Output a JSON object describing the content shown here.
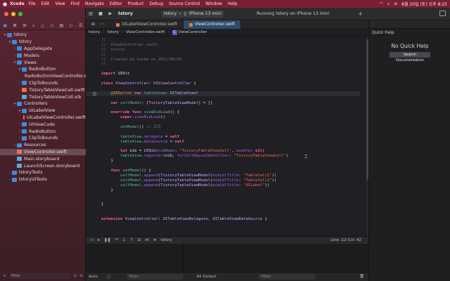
{
  "menubar": {
    "app": "Xcode",
    "items": [
      "File",
      "Edit",
      "View",
      "Find",
      "Navigate",
      "Editor",
      "Product",
      "Debug",
      "Source Control",
      "Window",
      "Help"
    ],
    "clock": "8월 20일 (토) 오후 8:25"
  },
  "toolbar": {
    "project_name": "tstory",
    "scheme": "tstory",
    "device": "iPhone 13 mini",
    "status": "Running tstory on iPhone 13 mini"
  },
  "tabs": [
    {
      "label": "UILabelViewController.swift",
      "active": false
    },
    {
      "label": "ViewController.swift",
      "active": true
    }
  ],
  "breadcrumb": [
    "tstory",
    "tstory",
    "ViewController.swift",
    "ViewController"
  ],
  "navigator": {
    "filter_placeholder": "Filter",
    "rows": [
      {
        "label": "tstory",
        "icon": "proj",
        "indent": 0,
        "disc": "▾"
      },
      {
        "label": "tstory",
        "icon": "folder",
        "indent": 1,
        "disc": "▾"
      },
      {
        "label": "AppDelegate",
        "icon": "folder",
        "indent": 2,
        "disc": "›"
      },
      {
        "label": "Models",
        "icon": "folder",
        "indent": 2,
        "disc": "›"
      },
      {
        "label": "Views",
        "icon": "folder",
        "indent": 2,
        "disc": "▾"
      },
      {
        "label": "RadioButton",
        "icon": "folder",
        "indent": 3,
        "disc": "▾"
      },
      {
        "label": "RadioButtonViewController.swift",
        "icon": "swift",
        "indent": 4,
        "disc": ""
      },
      {
        "label": "ClipToBounds",
        "icon": "folder",
        "indent": 3,
        "disc": "›"
      },
      {
        "label": "TistoryTableViewCell.swift",
        "icon": "swift",
        "indent": 3,
        "disc": ""
      },
      {
        "label": "TistoryTableViewCell.xib",
        "icon": "xib",
        "indent": 3,
        "disc": ""
      },
      {
        "label": "Controllers",
        "icon": "folder",
        "indent": 2,
        "disc": "▾"
      },
      {
        "label": "UILabelView",
        "icon": "folder",
        "indent": 3,
        "disc": "▾"
      },
      {
        "label": "UILabelViewController.swift",
        "icon": "swift",
        "indent": 4,
        "disc": ""
      },
      {
        "label": "UIViewCode",
        "icon": "folder",
        "indent": 3,
        "disc": "›"
      },
      {
        "label": "RadioButton",
        "icon": "folder",
        "indent": 3,
        "disc": "›"
      },
      {
        "label": "ClipToBounds",
        "icon": "folder",
        "indent": 3,
        "disc": "›"
      },
      {
        "label": "Resources",
        "icon": "folder",
        "indent": 2,
        "disc": "›"
      },
      {
        "label": "ViewController.swift",
        "icon": "swift",
        "indent": 2,
        "disc": "",
        "selected": true
      },
      {
        "label": "Main.storyboard",
        "icon": "xib",
        "indent": 2,
        "disc": ""
      },
      {
        "label": "LaunchScreen.storyboard",
        "icon": "xib",
        "indent": 2,
        "disc": ""
      },
      {
        "label": "tstoryTests",
        "icon": "folder",
        "indent": 1,
        "disc": "›"
      },
      {
        "label": "tstoryUITests",
        "icon": "folder",
        "indent": 1,
        "disc": "›"
      }
    ]
  },
  "code_lines": [
    [
      [
        "c-comment",
        "//"
      ]
    ],
    [
      [
        "c-comment",
        "//  ViewController.swift"
      ]
    ],
    [
      [
        "c-comment",
        "//  tstory"
      ]
    ],
    [
      [
        "c-comment",
        "//"
      ]
    ],
    [
      [
        "c-comment",
        "//  Created by tuche on 2022/08/02."
      ]
    ],
    [
      [
        "c-comment",
        "//"
      ]
    ],
    [],
    [
      [
        "c-kw",
        "import"
      ],
      [
        "c-plain",
        " UIKit"
      ]
    ],
    [],
    [
      [
        "c-kw",
        "class"
      ],
      [
        "c-plain",
        " "
      ],
      [
        "c-type",
        "ViewController"
      ],
      [
        "c-plain",
        ": "
      ],
      [
        "c-type",
        "UIViewController"
      ],
      [
        "c-plain",
        " {"
      ]
    ],
    [],
    [
      [
        "c-plain",
        "    "
      ],
      [
        "c-attr",
        "@IBOutlet"
      ],
      [
        "c-plain",
        " "
      ],
      [
        "c-kw",
        "var"
      ],
      [
        "c-plain",
        " "
      ],
      [
        "c-prop",
        "tableView"
      ],
      [
        "c-plain",
        ": "
      ],
      [
        "c-type",
        "UITableView"
      ],
      [
        "c-plain",
        "!"
      ]
    ],
    [],
    [
      [
        "c-plain",
        "    "
      ],
      [
        "c-kw",
        "var"
      ],
      [
        "c-plain",
        " "
      ],
      [
        "c-prop",
        "cellModel"
      ],
      [
        "c-plain",
        ": ["
      ],
      [
        "c-type",
        "TistoryTableViewModel"
      ],
      [
        "c-plain",
        "] = []"
      ]
    ],
    [],
    [
      [
        "c-plain",
        "    "
      ],
      [
        "c-kw",
        "override"
      ],
      [
        "c-plain",
        " "
      ],
      [
        "c-kw",
        "func"
      ],
      [
        "c-plain",
        " "
      ],
      [
        "c-prop",
        "viewDidLoad"
      ],
      [
        "c-plain",
        "() {"
      ]
    ],
    [
      [
        "c-plain",
        "        "
      ],
      [
        "c-kw",
        "super"
      ],
      [
        "c-plain",
        "."
      ],
      [
        "c-method",
        "viewDidLoad"
      ],
      [
        "c-plain",
        "()"
      ]
    ],
    [],
    [
      [
        "c-plain",
        "        "
      ],
      [
        "c-prop",
        "setModel"
      ],
      [
        "c-plain",
        "() "
      ],
      [
        "c-comment",
        "// 조회"
      ]
    ],
    [],
    [
      [
        "c-plain",
        "        "
      ],
      [
        "c-prop",
        "tableView"
      ],
      [
        "c-plain",
        "."
      ],
      [
        "c-method",
        "delegate"
      ],
      [
        "c-plain",
        " = "
      ],
      [
        "c-kw",
        "self"
      ]
    ],
    [
      [
        "c-plain",
        "        "
      ],
      [
        "c-prop",
        "tableView"
      ],
      [
        "c-plain",
        "."
      ],
      [
        "c-method",
        "dataSource"
      ],
      [
        "c-plain",
        " = "
      ],
      [
        "c-kw",
        "self"
      ]
    ],
    [],
    [
      [
        "c-plain",
        "        "
      ],
      [
        "c-kw",
        "let"
      ],
      [
        "c-plain",
        " nib = "
      ],
      [
        "c-type",
        "UINib"
      ],
      [
        "c-plain",
        "("
      ],
      [
        "c-method",
        "nibName"
      ],
      [
        "c-plain",
        ": "
      ],
      [
        "c-str",
        "\"TistoryTableViewCell\""
      ],
      [
        "c-plain",
        ", "
      ],
      [
        "c-method",
        "bundle"
      ],
      [
        "c-plain",
        ": "
      ],
      [
        "c-kw",
        "nil"
      ],
      [
        "c-plain",
        ")"
      ]
    ],
    [
      [
        "c-plain",
        "        "
      ],
      [
        "c-prop",
        "tableView"
      ],
      [
        "c-plain",
        "."
      ],
      [
        "c-method",
        "register"
      ],
      [
        "c-plain",
        "(nib, "
      ],
      [
        "c-method",
        "forCellReuseIdentifier"
      ],
      [
        "c-plain",
        ": "
      ],
      [
        "c-str",
        "\"TistoryTableViewCell\""
      ],
      [
        "c-plain",
        ")"
      ]
    ],
    [
      [
        "c-plain",
        "    }"
      ]
    ],
    [],
    [
      [
        "c-plain",
        "    "
      ],
      [
        "c-kw",
        "func"
      ],
      [
        "c-plain",
        " "
      ],
      [
        "c-prop",
        "setModel"
      ],
      [
        "c-plain",
        "() {"
      ]
    ],
    [
      [
        "c-plain",
        "        "
      ],
      [
        "c-prop",
        "cellModel"
      ],
      [
        "c-plain",
        "."
      ],
      [
        "c-method",
        "append"
      ],
      [
        "c-plain",
        "("
      ],
      [
        "c-type",
        "TistoryTableViewModel"
      ],
      [
        "c-plain",
        "("
      ],
      [
        "c-method",
        "midLblTitle"
      ],
      [
        "c-plain",
        ": "
      ],
      [
        "c-str",
        "\"TableCell1\""
      ],
      [
        "c-plain",
        "))"
      ]
    ],
    [
      [
        "c-plain",
        "        "
      ],
      [
        "c-prop",
        "cellModel"
      ],
      [
        "c-plain",
        "."
      ],
      [
        "c-method",
        "append"
      ],
      [
        "c-plain",
        "("
      ],
      [
        "c-type",
        "TistoryTableViewModel"
      ],
      [
        "c-plain",
        "("
      ],
      [
        "c-method",
        "midLblTitle"
      ],
      [
        "c-plain",
        ": "
      ],
      [
        "c-str",
        "\"TableCell2\""
      ],
      [
        "c-plain",
        "))"
      ]
    ],
    [
      [
        "c-plain",
        "        "
      ],
      [
        "c-prop",
        "cellModel"
      ],
      [
        "c-plain",
        "."
      ],
      [
        "c-method",
        "append"
      ],
      [
        "c-plain",
        "("
      ],
      [
        "c-type",
        "TistoryTableViewModel"
      ],
      [
        "c-plain",
        "("
      ],
      [
        "c-method",
        "midLblTitle"
      ],
      [
        "c-plain",
        ": "
      ],
      [
        "c-str",
        "\"UILabel\""
      ],
      [
        "c-plain",
        "))"
      ]
    ],
    [
      [
        "c-plain",
        "    }"
      ]
    ],
    [],
    [],
    [
      [
        "c-plain",
        "}"
      ]
    ],
    [],
    [],
    [
      [
        "c-kw",
        "extension"
      ],
      [
        "c-plain",
        " "
      ],
      [
        "c-type",
        "ViewController"
      ],
      [
        "c-plain",
        ": "
      ],
      [
        "c-type",
        "UITableViewDelegate"
      ],
      [
        "c-plain",
        ", "
      ],
      [
        "c-type",
        "UITableViewDataSource"
      ],
      [
        "c-plain",
        " {"
      ]
    ]
  ],
  "current_line_index": 11,
  "debug": {
    "target": "tstory",
    "line_col": "Line: 12  Col: 42"
  },
  "bottom": {
    "auto_label": "Auto",
    "filter_left": "Filter",
    "all_output": "All Output",
    "filter_right": "Filter"
  },
  "inspector": {
    "title": "Quick Help",
    "empty_label": "No Quick Help",
    "search_button": "Search Documentation"
  },
  "colors": {
    "menubar": "#7a1f33",
    "accent": "#4b9bff",
    "selected_row": "#6b4a54"
  }
}
